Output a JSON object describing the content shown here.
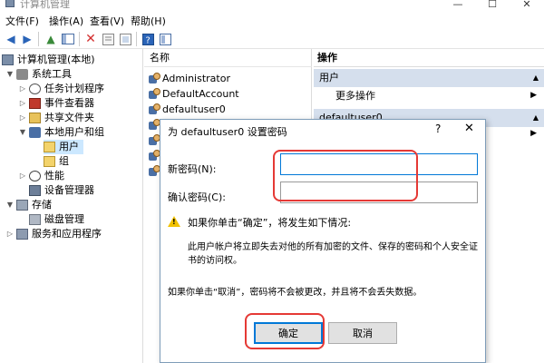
{
  "window": {
    "title": "计算机管理",
    "minimize": "—",
    "maximize": "☐",
    "close": "✕"
  },
  "menu": {
    "file": "文件(F)",
    "action": "操作(A)",
    "view": "查看(V)",
    "help": "帮助(H)"
  },
  "tree": {
    "root": "计算机管理(本地)",
    "system_tools": "系统工具",
    "task_scheduler": "任务计划程序",
    "event_viewer": "事件查看器",
    "shared_folders": "共享文件夹",
    "local_users_groups": "本地用户和组",
    "users": "用户",
    "groups": "组",
    "performance": "性能",
    "device_manager": "设备管理器",
    "storage": "存储",
    "disk_management": "磁盘管理",
    "services_apps": "服务和应用程序"
  },
  "list": {
    "header": "名称",
    "rows": [
      "Administrator",
      "DefaultAccount",
      "defaultuser0"
    ]
  },
  "actions": {
    "header": "操作",
    "section1": "用户",
    "more_actions": "更多操作",
    "section2": "defaultuser0"
  },
  "dialog": {
    "title": "为 defaultuser0 设置密码",
    "help": "?",
    "close": "✕",
    "new_password_label": "新密码(N):",
    "confirm_password_label": "确认密码(C):",
    "new_password_value": "",
    "confirm_password_value": "",
    "warning_line1": "如果你单击“确定”，将发生如下情况:",
    "warning_line2": "此用户帐户将立即失去对他的所有加密的文件、保存的密码和个人安全证",
    "warning_line3": "书的访问权。",
    "cancel_note": "如果你单击“取消”，密码将不会被更改，并且将不会丢失数据。",
    "ok_label": "确定",
    "cancel_label": "取消"
  },
  "colors": {
    "accent": "#0078d7",
    "highlight": "#e53935",
    "selection": "#cce8ff",
    "warning": "#f2c200"
  }
}
